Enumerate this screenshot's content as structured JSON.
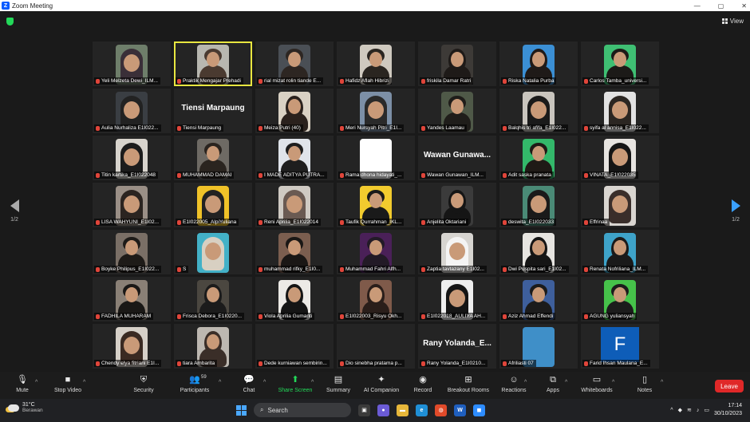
{
  "window": {
    "title": "Zoom Meeting",
    "app_letter": "Z",
    "controls": [
      "—",
      "▢",
      "✕"
    ]
  },
  "view_button": {
    "label": "View"
  },
  "pager": {
    "left_label": "1/2",
    "right_label": "1/2"
  },
  "participants": [
    {
      "name": "Yeli Melzeta Dewi_ILM...",
      "kind": "video",
      "bg": "#6e7e6a",
      "skin": "hijab",
      "tone": "#3a2f38"
    },
    {
      "name": "Praktik Mengajar Prehadi",
      "kind": "video",
      "bg": "#b8b7b0",
      "skin": "man",
      "tone": "#4a3a30",
      "active": true
    },
    {
      "name": "rial mizat rolin tiande E...",
      "kind": "video",
      "bg": "#4a4f55",
      "skin": "man",
      "tone": "#2d2622"
    },
    {
      "name": "Hafidz Aflah Hibrizi",
      "kind": "video",
      "bg": "#cfc9bf",
      "skin": "man",
      "tone": "#2a2520"
    },
    {
      "name": "friskila Damar Ratri",
      "kind": "video",
      "bg": "#3d3a37",
      "skin": "woman",
      "tone": "#1e1a18"
    },
    {
      "name": "Riska Natalia Purba",
      "kind": "video",
      "bg": "#3b8fd4",
      "skin": "woman",
      "tone": "#1f1a18"
    },
    {
      "name": "Carlos Tamba_universi...",
      "kind": "video",
      "bg": "#3fbf73",
      "skin": "man",
      "tone": "#1c1a18"
    },
    {
      "name": "Aulia Nurhaliza E1I022...",
      "kind": "video",
      "bg": "#3a3e43",
      "skin": "hijab",
      "tone": "#222"
    },
    {
      "name": "Tiensi Marpaung",
      "kind": "text",
      "big": "Tiensi Marpaung"
    },
    {
      "name": "Meiza Putri (40)",
      "kind": "video",
      "bg": "#d9d1c4",
      "skin": "woman",
      "tone": "#2a211d"
    },
    {
      "name": "Meri Nursyah Pitri_E1I...",
      "kind": "video",
      "bg": "#7c8fa6",
      "skin": "hijab",
      "tone": "#2a2a2a"
    },
    {
      "name": "Yandes Laamau",
      "kind": "video",
      "bg": "#4f5948",
      "skin": "man",
      "tone": "#1f1d1a"
    },
    {
      "name": "Balqhis tri afifa_E1I022...",
      "kind": "video",
      "bg": "#c9c5be",
      "skin": "hijab",
      "tone": "#1a1a1a"
    },
    {
      "name": "syifa al annisa_E1I022...",
      "kind": "video",
      "bg": "#e2e2e2",
      "skin": "hijab",
      "tone": "#2b2622"
    },
    {
      "name": "Titin kartika_E1I022048",
      "kind": "video",
      "bg": "#d8d4cd",
      "skin": "hijab",
      "tone": "#1c1c1c"
    },
    {
      "name": "MUHAMMAD DAMAI",
      "kind": "video",
      "bg": "#6e6a64",
      "skin": "man",
      "tone": "#2a241f"
    },
    {
      "name": "I MADE ADITYA PUTRA...",
      "kind": "video",
      "bg": "#e0e4ea",
      "skin": "man",
      "tone": "#1e1e1e"
    },
    {
      "name": "Rama dhona hidayati_...",
      "kind": "video",
      "bg": "#ffffff",
      "skin": "none",
      "tone": "#fff"
    },
    {
      "name": "Wawan Gunawan_ILM...",
      "kind": "text",
      "big": "Wawan Gunawa..."
    },
    {
      "name": "Adit saska pranata",
      "kind": "video",
      "bg": "#33b86a",
      "skin": "man",
      "tone": "#1f1a16"
    },
    {
      "name": "VINATA_E1I022035",
      "kind": "video",
      "bg": "#e7e4e0",
      "skin": "hijab",
      "tone": "#151515"
    },
    {
      "name": "LISA WAHYUNI_E1I02...",
      "kind": "video",
      "bg": "#9a8f86",
      "skin": "hijab",
      "tone": "#2b2420"
    },
    {
      "name": "E1I022005_AlpiYuliana",
      "kind": "video",
      "bg": "#f0c228",
      "skin": "hijab",
      "tone": "#222"
    },
    {
      "name": "Reni Aprilia_E1I022014",
      "kind": "video",
      "bg": "#cfcac3",
      "skin": "hijab",
      "tone": "#6a5a52"
    },
    {
      "name": "Taufik Qurrahman_IKL...",
      "kind": "video",
      "bg": "#f2cb2e",
      "skin": "man",
      "tone": "#1a1a1a"
    },
    {
      "name": "Anjelita Oktariani",
      "kind": "video",
      "bg": "#3b3b3b",
      "skin": "woman",
      "tone": "#151515"
    },
    {
      "name": "deswita_E1I022033",
      "kind": "video",
      "bg": "#4a8a76",
      "skin": "hijab",
      "tone": "#1a1a1a"
    },
    {
      "name": "Effrinaa",
      "kind": "video",
      "bg": "#d9d5d0",
      "skin": "hijab",
      "tone": "#3a2e2a"
    },
    {
      "name": "Boyke Philipus_E1I022...",
      "kind": "video",
      "bg": "#7a6f66",
      "skin": "man",
      "tone": "#1e1b18"
    },
    {
      "name": "S",
      "kind": "video",
      "bg": "#43b1c7",
      "skin": "hijab",
      "tone": "#d8d0c2"
    },
    {
      "name": "muhammad rifky_E1I0...",
      "kind": "video",
      "bg": "#7b5e4f",
      "skin": "man",
      "tone": "#1a1715"
    },
    {
      "name": "Muhammad Fahri Alfh...",
      "kind": "video",
      "bg": "#4a2058",
      "skin": "man",
      "tone": "#221a26"
    },
    {
      "name": "Zaptia tavtazany E1I02...",
      "kind": "video",
      "bg": "#d7d5d1",
      "skin": "hijab",
      "tone": "#f4f4f4"
    },
    {
      "name": "Dwi Puspita sari_E1I02...",
      "kind": "video",
      "bg": "#e7e5e1",
      "skin": "woman",
      "tone": "#151515"
    },
    {
      "name": "Renata Nofriliana_ILM...",
      "kind": "video",
      "bg": "#3ea3c9",
      "skin": "woman",
      "tone": "#1a1a1a"
    },
    {
      "name": "FADHILA MUHARAM",
      "kind": "video",
      "bg": "#8a8076",
      "skin": "man",
      "tone": "#1a1816"
    },
    {
      "name": "Frisca Debora_E1I0220...",
      "kind": "video",
      "bg": "#4b4740",
      "skin": "woman",
      "tone": "#1b1b1b"
    },
    {
      "name": "Viola Aprilia Gumanti",
      "kind": "video",
      "bg": "#eceae6",
      "skin": "woman",
      "tone": "#151515"
    },
    {
      "name": "E1I022003_Risyu Okh...",
      "kind": "video",
      "bg": "#7f5a4a",
      "skin": "woman",
      "tone": "#2a1e1a"
    },
    {
      "name": "E1I022018_AULIYA AH...",
      "kind": "video",
      "bg": "#eeeeee",
      "skin": "hijab",
      "tone": "#151515"
    },
    {
      "name": "Aziz Ahmad Effendi",
      "kind": "video",
      "bg": "#3e5f9c",
      "skin": "man",
      "tone": "#1b1b1b"
    },
    {
      "name": "AGUNG yuliansyah",
      "kind": "video",
      "bg": "#46c24a",
      "skin": "man",
      "tone": "#1c1c1c"
    },
    {
      "name": "Chendy elya fitriani E1I...",
      "kind": "video",
      "bg": "#d6d0c8",
      "skin": "hijab",
      "tone": "#3a2a22"
    },
    {
      "name": "tiara Ambarita",
      "kind": "video",
      "bg": "#bdb8b1",
      "skin": "woman",
      "tone": "#3a2e28"
    },
    {
      "name": "Dede kurniawan sembirin...",
      "kind": "blank"
    },
    {
      "name": "Dio sinebha pratama p...",
      "kind": "blank"
    },
    {
      "name": "Rany Yolanda_E1I0210...",
      "kind": "text",
      "big": "Rany Yolanda_E..."
    },
    {
      "name": "Afriliasti 07",
      "kind": "video",
      "bg": "#3f8fc8",
      "skin": "none",
      "tone": "#3f8fc8"
    },
    {
      "name": "Farid Ihsan Maulana_E...",
      "kind": "avatar",
      "big": "F",
      "avatar_color": "#0e5db8"
    }
  ],
  "toolbar": {
    "mute": "Mute",
    "stop_video": "Stop Video",
    "security": "Security",
    "participants": "Participants",
    "participants_count": "59",
    "chat": "Chat",
    "share_screen": "Share Screen",
    "summary": "Summary",
    "ai_companion": "AI Companion",
    "record": "Record",
    "breakout": "Breakout Rooms",
    "reactions": "Reactions",
    "apps": "Apps",
    "whiteboards": "Whiteboards",
    "notes": "Notes",
    "leave": "Leave"
  },
  "taskbar": {
    "temp": "31°C",
    "weather": "Berawan",
    "search": "Search",
    "time": "17:14",
    "date": "30/10/2023"
  },
  "colors": {
    "leave": "#e02828",
    "accent_green": "#23d959",
    "active_outline": "#e8e640"
  }
}
